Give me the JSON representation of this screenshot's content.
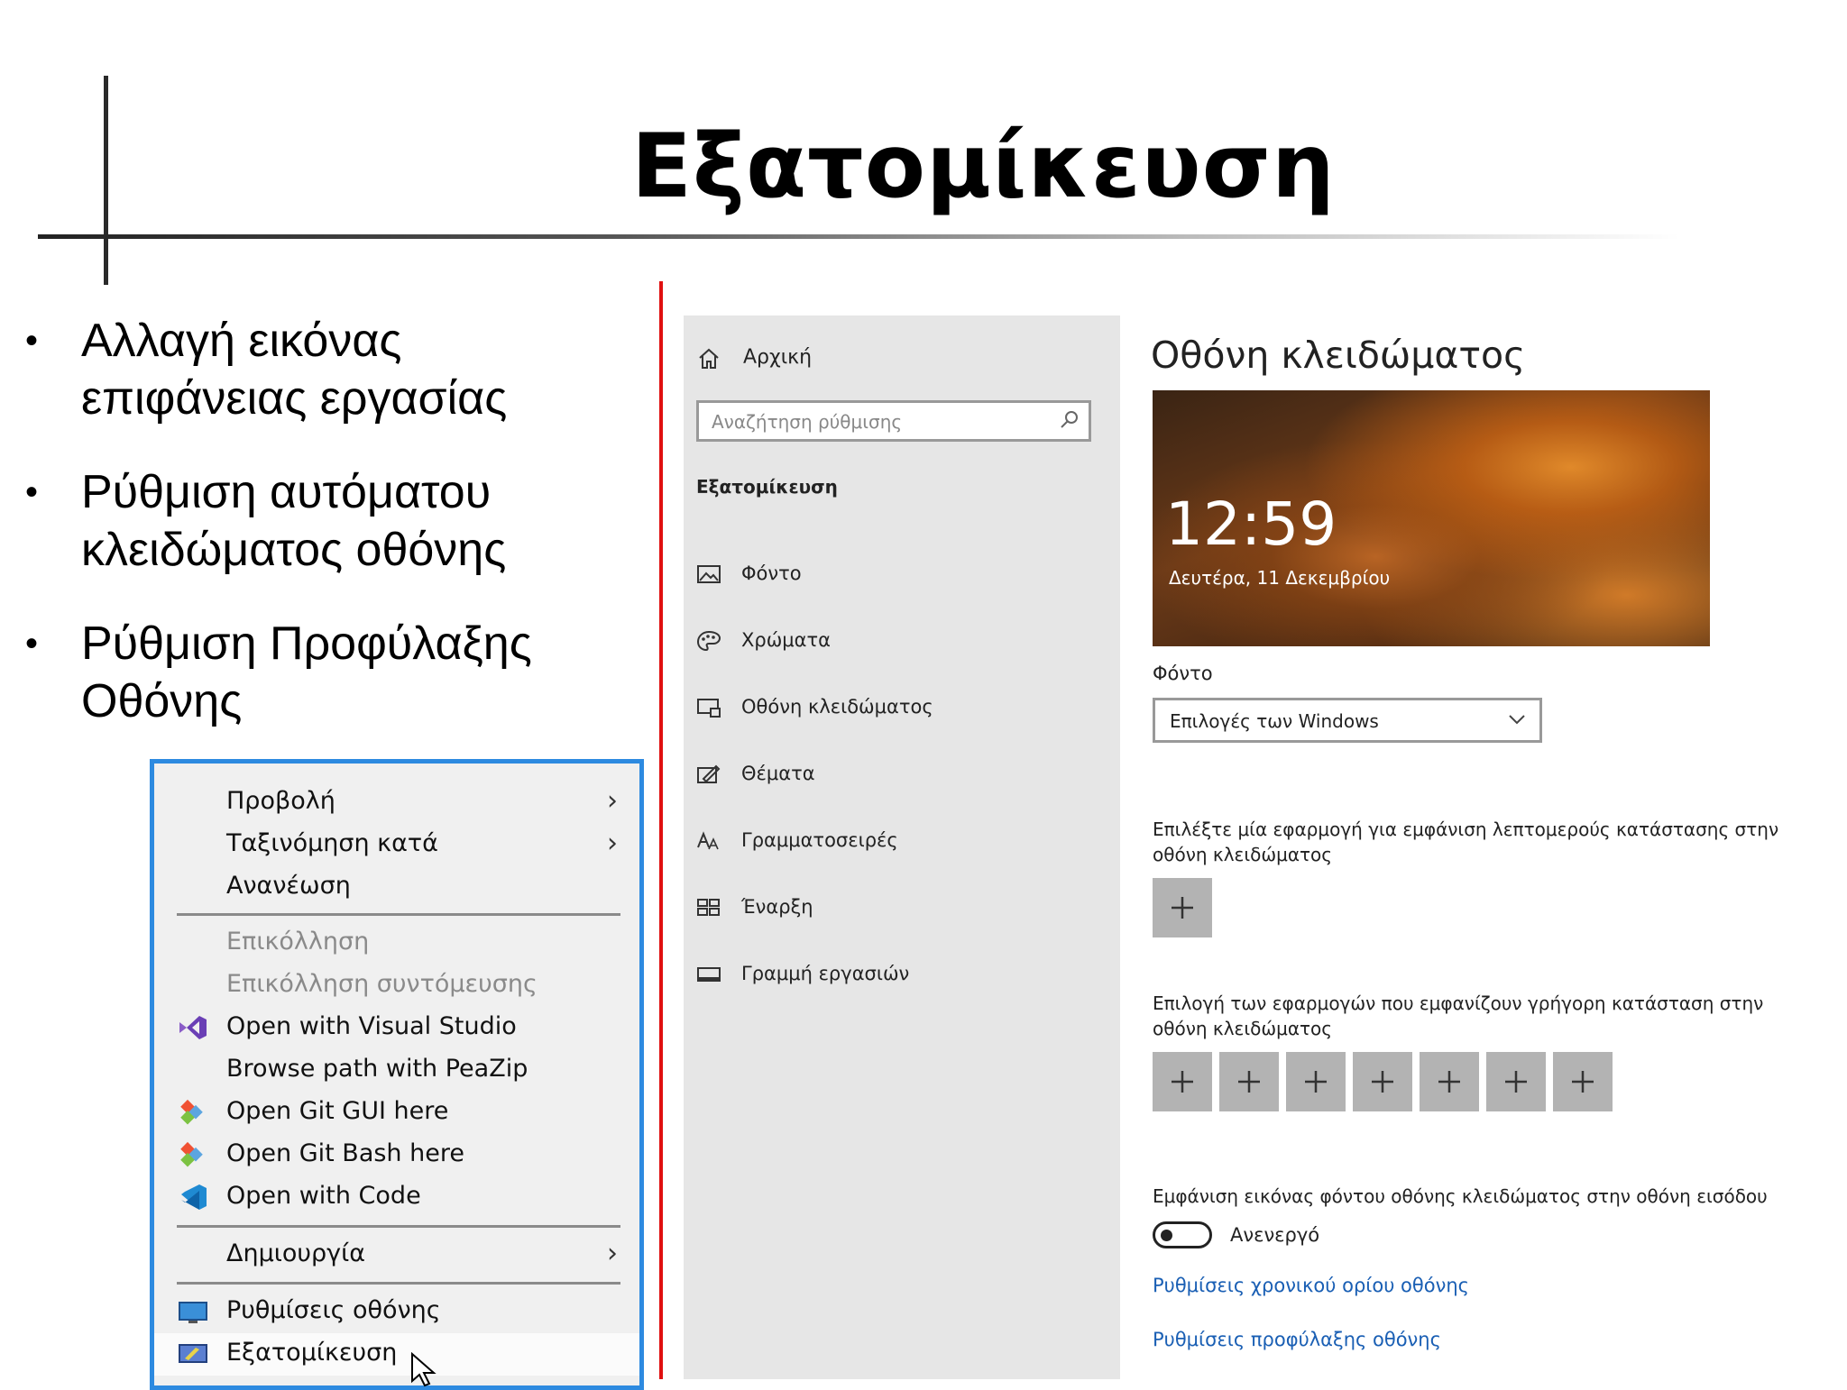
{
  "slide": {
    "title": "Εξατομίκευση",
    "bullets": [
      {
        "line1": "Αλλαγή εικόνας",
        "line2": "επιφάνειας εργασίας"
      },
      {
        "line1": "Ρύθμιση αυτόματου",
        "line2": "κλειδώματος οθόνης"
      },
      {
        "line1": "Ρύθμιση Προφύλαξης",
        "line2": "Οθόνης"
      }
    ],
    "bullet_char": "•"
  },
  "context_menu": {
    "items": [
      {
        "label": "Προβολή",
        "has_submenu": true,
        "disabled": false,
        "icon": null
      },
      {
        "label": "Ταξινόμηση κατά",
        "has_submenu": true,
        "disabled": false,
        "icon": null
      },
      {
        "label": "Ανανέωση",
        "has_submenu": false,
        "disabled": false,
        "icon": null
      },
      {
        "label": "Επικόλληση",
        "has_submenu": false,
        "disabled": true,
        "icon": null
      },
      {
        "label": "Επικόλληση συντόμευσης",
        "has_submenu": false,
        "disabled": true,
        "icon": null
      },
      {
        "label": "Open with Visual Studio",
        "has_submenu": false,
        "disabled": false,
        "icon": "visual-studio-icon"
      },
      {
        "label": "Browse path with PeaZip",
        "has_submenu": false,
        "disabled": false,
        "icon": null
      },
      {
        "label": "Open Git GUI here",
        "has_submenu": false,
        "disabled": false,
        "icon": "git-icon"
      },
      {
        "label": "Open Git Bash here",
        "has_submenu": false,
        "disabled": false,
        "icon": "git-icon"
      },
      {
        "label": "Open with Code",
        "has_submenu": false,
        "disabled": false,
        "icon": "vscode-icon"
      },
      {
        "label": "Δημιουργία",
        "has_submenu": true,
        "disabled": false,
        "icon": null
      },
      {
        "label": "Ρυθμίσεις οθόνης",
        "has_submenu": false,
        "disabled": false,
        "icon": "display-settings-icon"
      },
      {
        "label": "Εξατομίκευση",
        "has_submenu": false,
        "disabled": false,
        "icon": "personalize-icon"
      }
    ],
    "arrow_glyph": "›"
  },
  "settings": {
    "sidebar": {
      "home_label": "Αρχική",
      "search_placeholder": "Αναζήτηση ρύθμισης",
      "section_heading": "Εξατομίκευση",
      "items": [
        {
          "label": "Φόντο",
          "icon": "image-icon"
        },
        {
          "label": "Χρώματα",
          "icon": "palette-icon"
        },
        {
          "label": "Οθόνη κλειδώματος",
          "icon": "lock-screen-icon"
        },
        {
          "label": "Θέματα",
          "icon": "themes-icon"
        },
        {
          "label": "Γραμματοσειρές",
          "icon": "fonts-icon"
        },
        {
          "label": "Έναρξη",
          "icon": "start-icon"
        },
        {
          "label": "Γραμμή εργασιών",
          "icon": "taskbar-icon"
        }
      ]
    },
    "lock_screen": {
      "title": "Οθόνη κλειδώματος",
      "preview_time": "12:59",
      "preview_date": "Δευτέρα, 11 Δεκεμβρίου",
      "background_label": "Φόντο",
      "background_value": "Επιλογές των Windows",
      "detailed_status_desc_line1": "Επιλέξτε μία εφαρμογή για εμφάνιση λεπτομερούς κατάστασης στην",
      "detailed_status_desc_line2": "οθόνη κλειδώματος",
      "quick_status_desc_line1": "Επιλογή των εφαρμογών που εμφανίζουν γρήγορη κατάσταση στην",
      "quick_status_desc_line2": "οθόνη κλειδώματος",
      "quick_status_slots": 7,
      "show_bg_desc": "Εμφάνιση εικόνας φόντου οθόνης κλειδώματος στην οθόνη εισόδου",
      "show_bg_state": "Ανενεργό",
      "link_timeout": "Ρυθμίσεις χρονικού ορίου οθόνης",
      "link_screensaver": "Ρυθμίσεις προφύλαξης οθόνης"
    }
  },
  "colors": {
    "accent_link": "#1a5fb4",
    "menu_border": "#2d8ae0",
    "divider_red": "#e01010",
    "sidebar_bg": "#e6e6e6",
    "plus_tile": "#b3b3b3"
  }
}
